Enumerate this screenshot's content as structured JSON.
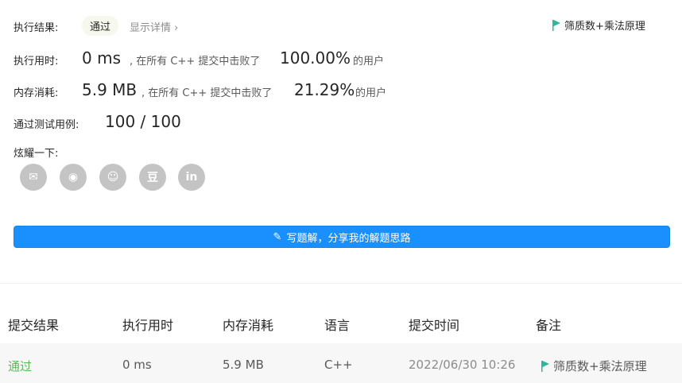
{
  "result": {
    "label": "执行结果:",
    "status": "通过",
    "details_link": "显示详情",
    "details_chevron": "›",
    "tag": "筛质数+乘法原理",
    "tag_color": "#2db7a0"
  },
  "runtime": {
    "label": "执行用时:",
    "value": "0 ms",
    "mid": ", 在所有 C++ 提交中击败了",
    "percent": "100.00%",
    "suffix": "的用户"
  },
  "memory": {
    "label": "内存消耗:",
    "value": "5.9 MB",
    "mid": ", 在所有 C++ 提交中击败了",
    "percent": "21.29%",
    "suffix": "的用户"
  },
  "tests": {
    "label": "通过测试用例:",
    "value": "100 / 100"
  },
  "share": {
    "label": "炫耀一下:",
    "icons": [
      "wechat-icon",
      "weibo-icon",
      "qq-icon",
      "douban-icon",
      "linkedin-icon"
    ],
    "glyphs": [
      "✉",
      "◉",
      "☺",
      "豆",
      "in"
    ]
  },
  "write_solution": {
    "icon": "✎",
    "label": "写题解，分享我的解题思路"
  },
  "table": {
    "headers": [
      "提交结果",
      "执行用时",
      "内存消耗",
      "语言",
      "提交时间",
      "备注"
    ],
    "row": {
      "status": "通过",
      "runtime": "0 ms",
      "memory": "5.9 MB",
      "language": "C++",
      "time": "2022/06/30 10:26",
      "note": "筛质数+乘法原理"
    },
    "status_color": "#5cb85c"
  }
}
